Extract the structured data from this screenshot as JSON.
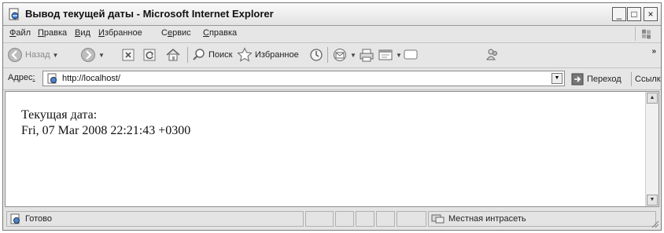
{
  "window": {
    "title": "Вывод текущей даты - Microsoft Internet Explorer",
    "controls": {
      "minimize": "_",
      "maximize": "□",
      "close": "×"
    }
  },
  "menu": [
    {
      "hotkey": "Ф",
      "rest": "айл"
    },
    {
      "hotkey": "П",
      "rest": "равка"
    },
    {
      "hotkey": "В",
      "rest": "ид"
    },
    {
      "hotkey": "И",
      "rest": "збранное"
    },
    {
      "pre": "С",
      "hotkey": "е",
      "rest": "рвис"
    },
    {
      "hotkey": "С",
      "rest": "правка"
    }
  ],
  "toolbar": {
    "back_label": "Назад",
    "search_label": "Поиск",
    "favorites_label": "Избранное",
    "more": "»"
  },
  "address": {
    "label_pre": "Адрес",
    "label_hotkey": ":",
    "value": "http://localhost/",
    "go_label": "Переход",
    "links_label": "Ссылки",
    "links_more": "»"
  },
  "content": {
    "line1": "Текущая дата:",
    "line2": "Fri, 07 Mar 2008 22:21:43 +0300"
  },
  "status": {
    "text": "Готово",
    "zone": "Местная интрасеть"
  }
}
